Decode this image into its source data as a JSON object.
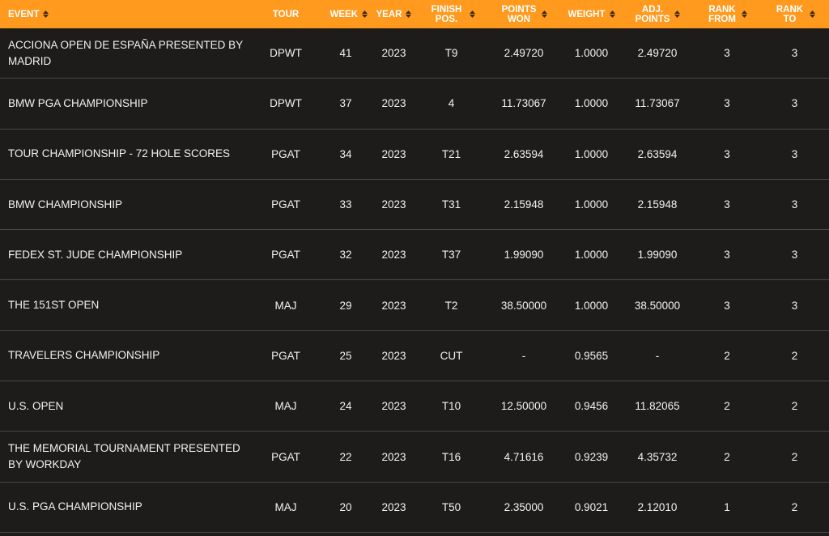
{
  "table": {
    "columns": [
      {
        "key": "event",
        "label": "EVENT",
        "sortable": true
      },
      {
        "key": "tour",
        "label": "TOUR",
        "sortable": false
      },
      {
        "key": "week",
        "label": "WEEK",
        "sortable": true
      },
      {
        "key": "year",
        "label": "YEAR",
        "sortable": true
      },
      {
        "key": "finish",
        "label": "FINISH POS.",
        "sortable": true
      },
      {
        "key": "points",
        "label": "POINTS WON",
        "sortable": true
      },
      {
        "key": "weight",
        "label": "WEIGHT",
        "sortable": true
      },
      {
        "key": "adj",
        "label": "ADJ. POINTS",
        "sortable": true
      },
      {
        "key": "rank_from",
        "label": "RANK FROM",
        "sortable": true
      },
      {
        "key": "rank_to",
        "label": "RANK TO",
        "sortable": true
      }
    ],
    "rows": [
      {
        "event": "ACCIONA OPEN DE ESPAÑA PRESENTED BY MADRID",
        "tour": "DPWT",
        "week": "41",
        "year": "2023",
        "finish": "T9",
        "points": "2.49720",
        "weight": "1.0000",
        "adj": "2.49720",
        "rank_from": "3",
        "rank_to": "3"
      },
      {
        "event": "BMW PGA CHAMPIONSHIP",
        "tour": "DPWT",
        "week": "37",
        "year": "2023",
        "finish": "4",
        "points": "11.73067",
        "weight": "1.0000",
        "adj": "11.73067",
        "rank_from": "3",
        "rank_to": "3"
      },
      {
        "event": "TOUR CHAMPIONSHIP - 72 HOLE SCORES",
        "tour": "PGAT",
        "week": "34",
        "year": "2023",
        "finish": "T21",
        "points": "2.63594",
        "weight": "1.0000",
        "adj": "2.63594",
        "rank_from": "3",
        "rank_to": "3"
      },
      {
        "event": "BMW CHAMPIONSHIP",
        "tour": "PGAT",
        "week": "33",
        "year": "2023",
        "finish": "T31",
        "points": "2.15948",
        "weight": "1.0000",
        "adj": "2.15948",
        "rank_from": "3",
        "rank_to": "3"
      },
      {
        "event": "FEDEX ST. JUDE CHAMPIONSHIP",
        "tour": "PGAT",
        "week": "32",
        "year": "2023",
        "finish": "T37",
        "points": "1.99090",
        "weight": "1.0000",
        "adj": "1.99090",
        "rank_from": "3",
        "rank_to": "3"
      },
      {
        "event": "THE 151ST OPEN",
        "tour": "MAJ",
        "week": "29",
        "year": "2023",
        "finish": "T2",
        "points": "38.50000",
        "weight": "1.0000",
        "adj": "38.50000",
        "rank_from": "3",
        "rank_to": "3"
      },
      {
        "event": "TRAVELERS CHAMPIONSHIP",
        "tour": "PGAT",
        "week": "25",
        "year": "2023",
        "finish": "CUT",
        "points": "-",
        "weight": "0.9565",
        "adj": "-",
        "rank_from": "2",
        "rank_to": "2"
      },
      {
        "event": "U.S. OPEN",
        "tour": "MAJ",
        "week": "24",
        "year": "2023",
        "finish": "T10",
        "points": "12.50000",
        "weight": "0.9456",
        "adj": "11.82065",
        "rank_from": "2",
        "rank_to": "2"
      },
      {
        "event": "THE MEMORIAL TOURNAMENT PRESENTED BY WORKDAY",
        "tour": "PGAT",
        "week": "22",
        "year": "2023",
        "finish": "T16",
        "points": "4.71616",
        "weight": "0.9239",
        "adj": "4.35732",
        "rank_from": "2",
        "rank_to": "2"
      },
      {
        "event": "U.S. PGA CHAMPIONSHIP",
        "tour": "MAJ",
        "week": "20",
        "year": "2023",
        "finish": "T50",
        "points": "2.35000",
        "weight": "0.9021",
        "adj": "2.12010",
        "rank_from": "1",
        "rank_to": "2"
      }
    ]
  },
  "colors": {
    "header_bg": "#ff9a1f",
    "body_bg": "#1e1c1b",
    "row_divider": "#4a4846",
    "text": "#f2f2f2"
  },
  "icons": {
    "sort": "sort-arrows-icon"
  }
}
